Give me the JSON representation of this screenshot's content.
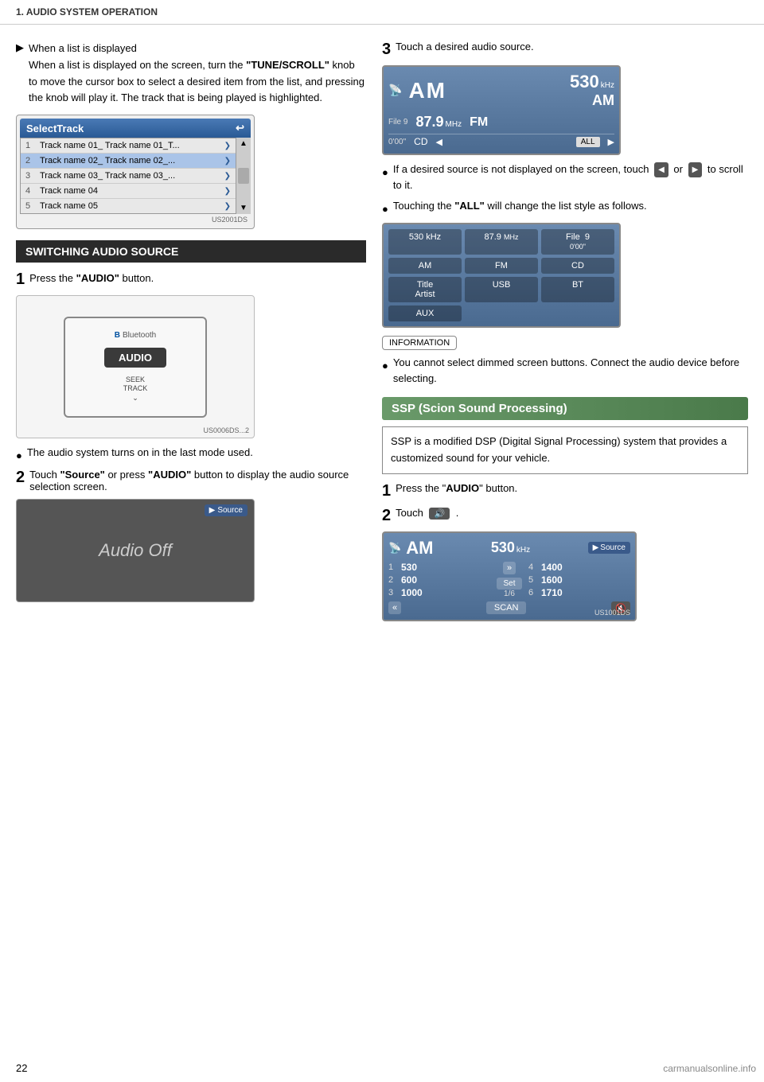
{
  "header": {
    "title": "1. AUDIO SYSTEM OPERATION"
  },
  "page_number": "22",
  "watermark": "carmanualsonline.info",
  "left_col": {
    "intro_bullet": {
      "arrow": "▶",
      "text1": "When a list is displayed",
      "text2": "When a list is displayed on the screen, turn the ",
      "bold1": "\"TUNE/SCROLL\"",
      "text3": " knob to move the cursor box to select a desired item from the list, and pressing the knob will play it. The track that is being played is highlighted."
    },
    "select_track": {
      "header": "SelectTrack",
      "back_icon": "↩",
      "tracks": [
        {
          "num": "1",
          "text": "Track name 01_ Track name 01_T...",
          "arrow": "❯"
        },
        {
          "num": "2",
          "text": "Track name 02_ Track name 02_...",
          "arrow": "❯"
        },
        {
          "num": "3",
          "text": "Track name 03_ Track name 03_...",
          "arrow": "❯"
        },
        {
          "num": "4",
          "text": "Track name 04",
          "arrow": "❯"
        },
        {
          "num": "5",
          "text": "Track name 05",
          "arrow": "❯"
        }
      ],
      "code": "US2001DS"
    },
    "switching_section": {
      "header": "SWITCHING AUDIO SOURCE"
    },
    "step1": {
      "num": "1",
      "text1": "Press the ",
      "bold1": "\"AUDIO\"",
      "text2": " button.",
      "bluetooth_label": "Bluetooth",
      "audio_btn": "AUDIO",
      "seek_label": "SEEK\nTRACK",
      "code": "US0006DS...2"
    },
    "bullet_note": {
      "text1": "The audio system turns on in the last mode used."
    },
    "step2": {
      "num": "2",
      "text1": "Touch ",
      "bold1": "\"Source\"",
      "text2": " or press ",
      "bold2": "\"AUDIO\"",
      "text3": " button to display the audio source selection screen.",
      "source_label": "Source",
      "audio_off": "Audio Off"
    }
  },
  "right_col": {
    "step3": {
      "num": "3",
      "text": "Touch a desired audio source.",
      "am_screen": {
        "antenna_icon": "📡",
        "am_label": "AM",
        "freq": "530",
        "khz": "kHz",
        "file_label": "File",
        "file_num": "9",
        "mhz_freq": "87.9",
        "mhz_label": "MHz",
        "am_right": "AM",
        "time": "0'00\"",
        "fm_label": "FM",
        "cd_label": "CD",
        "all_btn": "ALL"
      }
    },
    "bullet1": {
      "text1": "If a desired source is not displayed on the screen, touch",
      "text2": "or",
      "text3": "to scroll to it."
    },
    "bullet2": {
      "text1": "Touching the ",
      "bold1": "\"ALL\"",
      "text2": " will change the list style as follows."
    },
    "list_screen": {
      "cells": [
        {
          "val": "530 kHz",
          "sub": ""
        },
        {
          "val": "87.9",
          "sub": "MHz"
        },
        {
          "val": "File  9",
          "sub": "0'00\""
        },
        {
          "val": "AM",
          "sub": ""
        },
        {
          "val": "FM",
          "sub": ""
        },
        {
          "val": "CD",
          "sub": ""
        },
        {
          "val": "Title",
          "sub": "Artist"
        },
        {
          "val": "USB",
          "sub": ""
        },
        {
          "val": "BT",
          "sub": ""
        },
        {
          "val": "",
          "sub": "AUX"
        }
      ]
    },
    "info_box": {
      "label": "INFORMATION",
      "text": "You cannot select dimmed screen buttons. Connect the audio device before selecting."
    },
    "ssp": {
      "header": "SSP (Scion Sound Processing)",
      "desc": "SSP is a modified DSP (Digital Signal Processing) system that provides a customized sound for your  vehicle.",
      "step1": {
        "num": "1",
        "text1": "Press the \"",
        "bold1": "AUDIO",
        "text2": "\" button."
      },
      "step2": {
        "num": "2",
        "text1": "Touch",
        "icon_label": "🔊",
        "text2": "."
      },
      "scan_screen": {
        "antenna_icon": "📡",
        "am_label": "AM",
        "freq": "530",
        "khz": "kHz",
        "source_label": "Source",
        "rows_left": [
          {
            "num": "1",
            "val": "530"
          },
          {
            "num": "2",
            "val": "600"
          },
          {
            "num": "3",
            "val": "1000"
          }
        ],
        "rows_right": [
          {
            "num": "4",
            "val": "1400"
          },
          {
            "num": "5",
            "val": "1600"
          },
          {
            "num": "6",
            "val": "1710"
          }
        ],
        "set_btn": "Set",
        "page_label": "1/6",
        "fwd_btn": "»",
        "bwd_btn": "«",
        "scan_btn": "SCAN",
        "mute_icon": "🔇",
        "code": "US1001DS"
      }
    }
  }
}
